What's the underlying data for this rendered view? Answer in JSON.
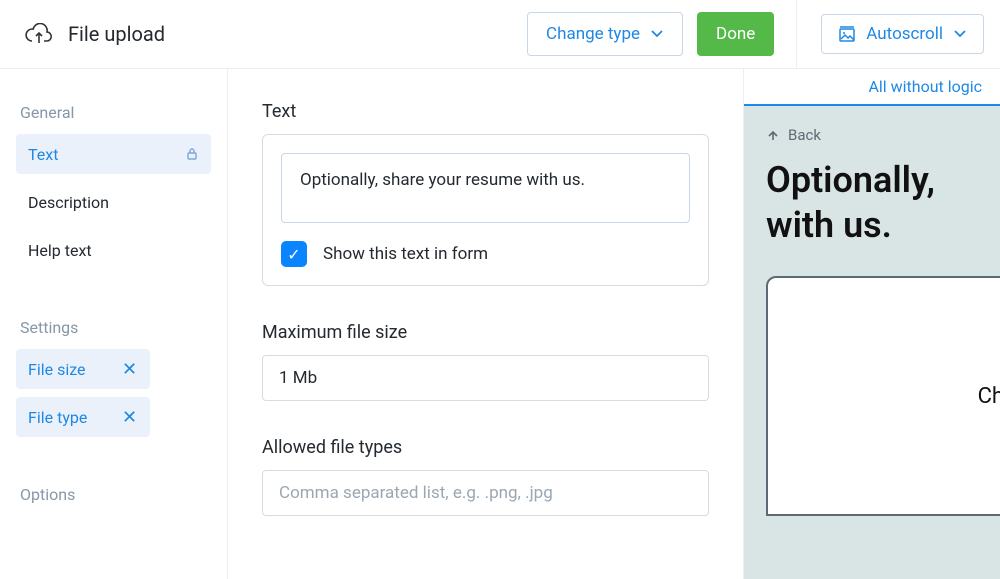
{
  "header": {
    "title": "File upload",
    "change_type": "Change type",
    "done": "Done",
    "autoscroll": "Autoscroll"
  },
  "sidebar": {
    "section_general": "General",
    "items_general": [
      {
        "label": "Text",
        "active": true,
        "locked": true
      },
      {
        "label": "Description"
      },
      {
        "label": "Help text"
      }
    ],
    "section_settings": "Settings",
    "items_settings": [
      {
        "label": "File size"
      },
      {
        "label": "File type"
      }
    ],
    "section_options": "Options"
  },
  "editor": {
    "text_label": "Text",
    "text_value": "Optionally, share your resume with us.",
    "show_in_form_label": "Show this text in form",
    "show_in_form_checked": true,
    "max_size_label": "Maximum file size",
    "max_size_value": "1 Mb",
    "allowed_types_label": "Allowed file types",
    "allowed_types_placeholder": "Comma separated list, e.g. .png, .jpg"
  },
  "preview": {
    "all_without_logic": "All without logic",
    "back": "Back",
    "title_line1": "Optionally,",
    "title_line2": "with us.",
    "card_text": "Ch"
  }
}
